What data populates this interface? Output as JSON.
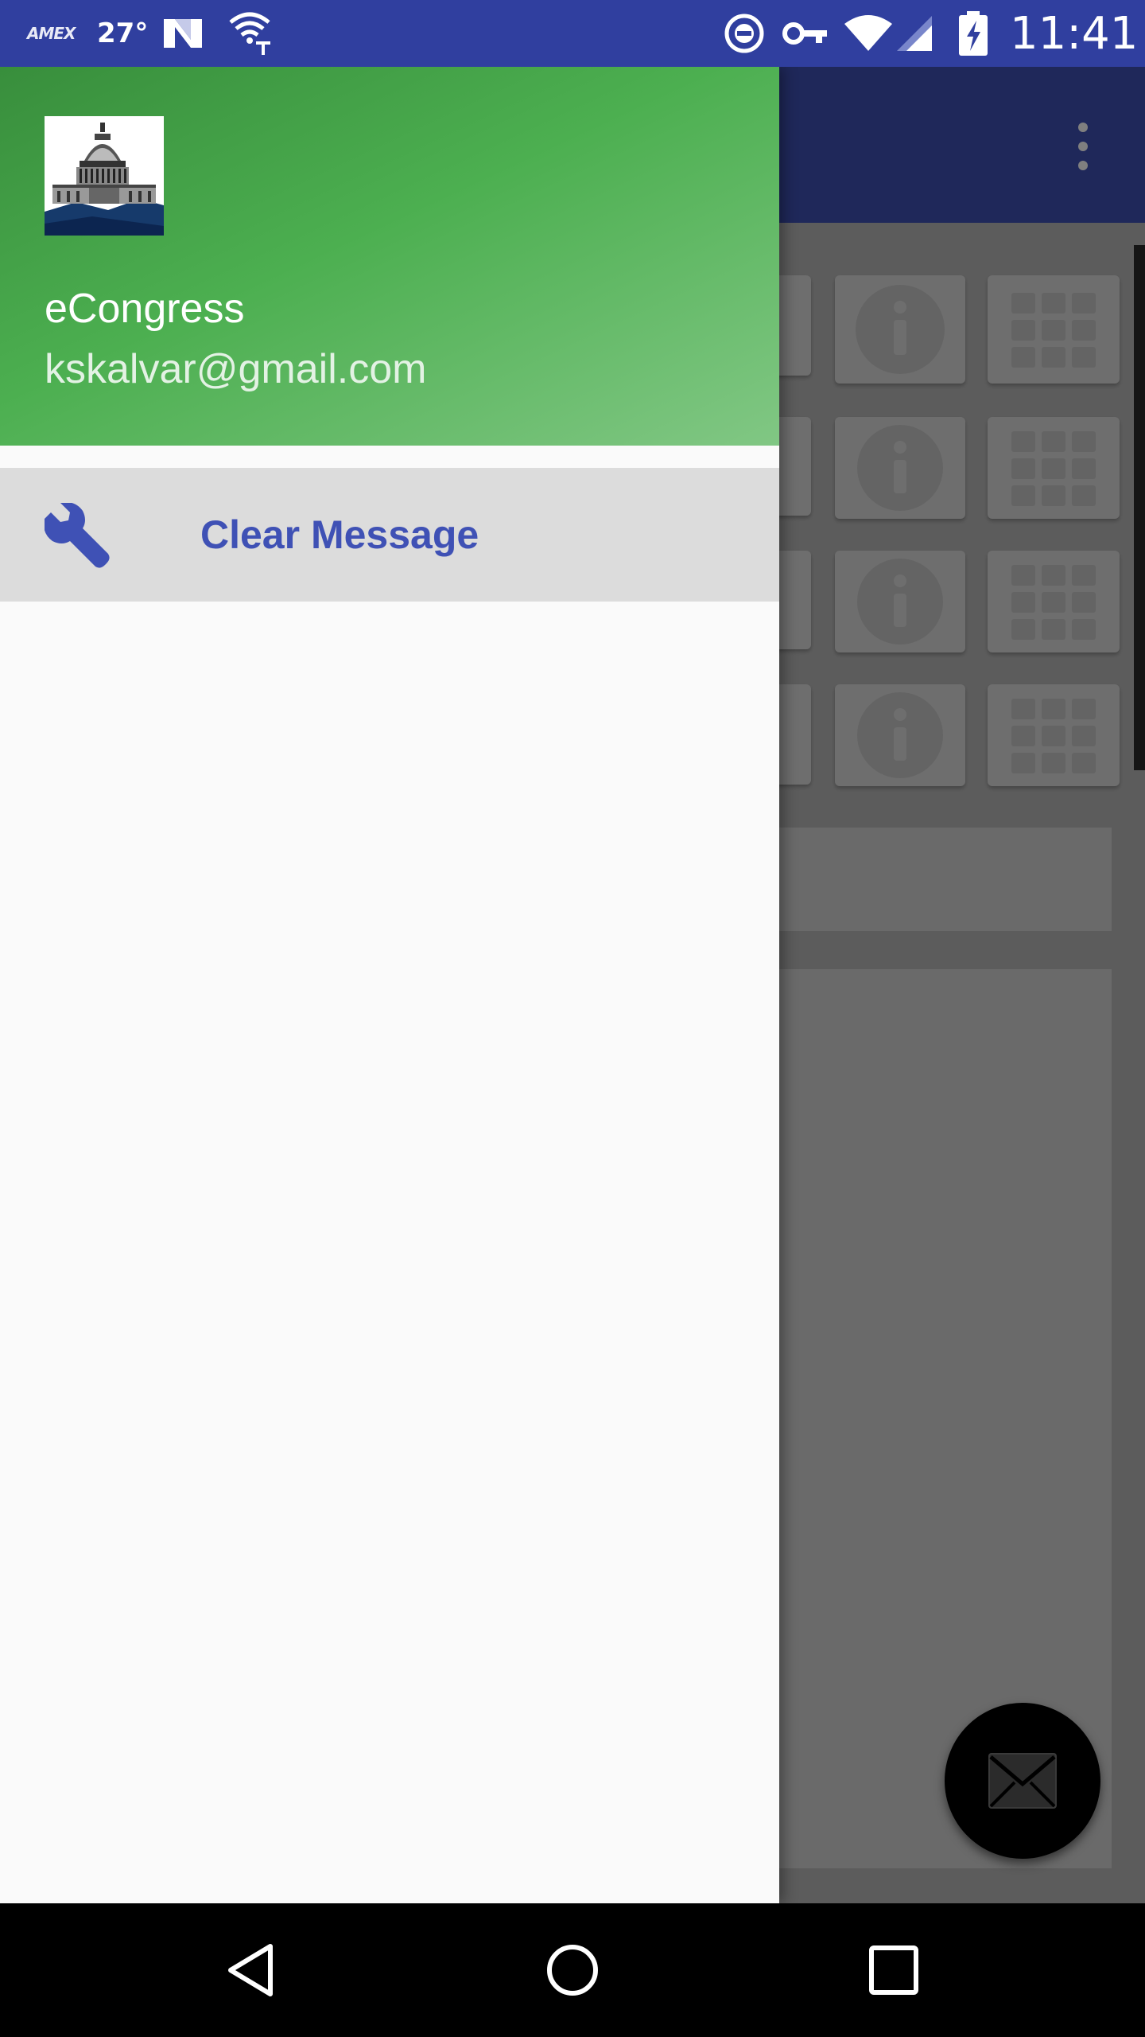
{
  "status_bar": {
    "amex_label": "AMEX",
    "temperature": "27°",
    "time": "11:41",
    "icons": [
      "amex-icon",
      "weather-icon",
      "n-logo-icon",
      "wifi-tmobile-icon",
      "do-not-disturb-icon",
      "vpn-key-icon",
      "wifi-signal-icon",
      "cell-signal-icon",
      "battery-charging-icon"
    ]
  },
  "colors": {
    "status_bar": "#303f9f",
    "toolbar": "#3f51b5",
    "header_gradient_start": "#388e3c",
    "header_gradient_end": "#81c784",
    "menu_label": "#3f51b5",
    "menu_icon": "#3f51b5",
    "drawer_background": "#fafafa",
    "selected_item_background": "#dcdcdc"
  },
  "drawer": {
    "header": {
      "logo_icon": "capitol-building-icon",
      "app_name": "eCongress",
      "account_email": "kskalvar@gmail.com"
    },
    "menu_items": [
      {
        "icon": "wrench-icon",
        "label": "Clear Message"
      }
    ]
  },
  "background_app": {
    "toolbar_icon": "more-vert-icon",
    "card_icons": [
      "info-icon",
      "grid-icon"
    ],
    "fab_icon": "email-icon"
  },
  "nav_bar": {
    "icons": [
      "back-icon",
      "home-icon",
      "recents-icon"
    ]
  }
}
